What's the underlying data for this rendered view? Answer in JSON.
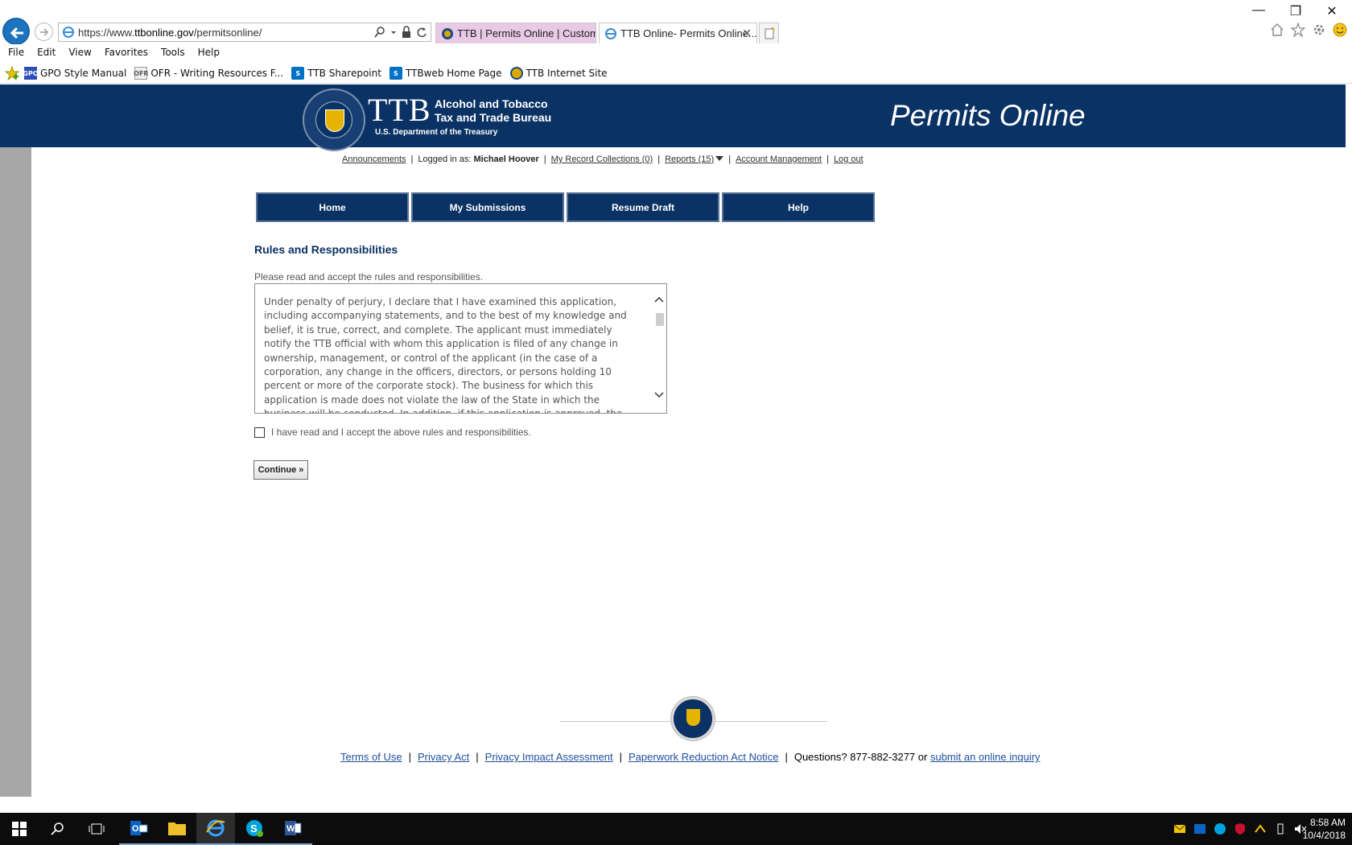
{
  "browser": {
    "address": {
      "prefix": "https://www.",
      "domain": "ttbonline.gov",
      "path": "/permitsonline/"
    },
    "tabs": [
      {
        "label": "TTB | Permits Online | Custom..."
      },
      {
        "label": "TTB Online- Permits Online..."
      }
    ],
    "menu": [
      "File",
      "Edit",
      "View",
      "Favorites",
      "Tools",
      "Help"
    ],
    "favorites": [
      {
        "label": "GPO Style Manual",
        "icon": "GPO"
      },
      {
        "label": "OFR - Writing Resources F...",
        "icon": "OFR"
      },
      {
        "label": "TTB Sharepoint",
        "icon": "S"
      },
      {
        "label": "TTBweb Home Page",
        "icon": "S"
      },
      {
        "label": "TTB Internet Site",
        "icon": ""
      }
    ]
  },
  "header": {
    "logo": "TTB",
    "agency_line1": "Alcohol and Tobacco",
    "agency_line2": "Tax and Trade Bureau",
    "department": "U.S. Department of the Treasury",
    "product": "Permits Online"
  },
  "userbar": {
    "announcements": "Announcements",
    "logged_in_prefix": "Logged in as:",
    "user_name": "Michael Hoover",
    "record_collections": "My Record Collections (0)",
    "reports": "Reports (15)",
    "account_management": "Account Management",
    "logout": "Log out"
  },
  "nav": {
    "home": "Home",
    "submissions": "My Submissions",
    "resume": "Resume Draft",
    "help": "Help"
  },
  "main": {
    "title": "Rules and Responsibilities",
    "instructions": "Please read and accept the rules and responsibilities.",
    "rules_text": "Under penalty of perjury, I declare that I have examined this application, including accompanying statements, and to the best of my knowledge and belief, it is true, correct, and complete. The applicant must immediately notify the TTB official with whom this application is filed of any change in ownership, management, or control of the applicant (in the case of a corporation, any change in the officers, directors, or persons holding 10 percent or more of the corporate stock). The business for which this application is made does not violate the law of the State in which the business will be conducted. In addition, if this application is approved, the applicant will conduct operations",
    "accept_label": "I have read and I accept the above rules and responsibilities.",
    "continue": "Continue »"
  },
  "footer": {
    "terms": "Terms of Use",
    "privacy": "Privacy Act",
    "pia": "Privacy Impact Assessment",
    "paperwork": "Paperwork Reduction Act Notice",
    "questions": "Questions? 877-882-3277 or",
    "inquiry": "submit an online inquiry"
  },
  "taskbar": {
    "time": "8:58 AM",
    "date": "10/4/2018"
  },
  "colors": {
    "brand_navy": "#0a3264",
    "tab_highlight": "#e8c9e6",
    "link_blue": "#1f4f9d"
  }
}
